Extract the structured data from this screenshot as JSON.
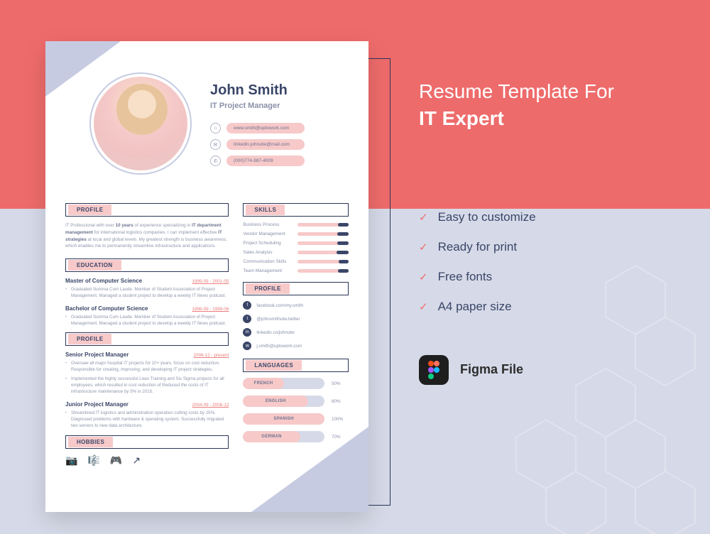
{
  "promo": {
    "heading_line1": "Resume Template For",
    "heading_line2": "IT Expert",
    "features": [
      "Easy to customize",
      "Ready for print",
      "Free fonts",
      "A4 paper size"
    ],
    "figma_label": "Figma File"
  },
  "resume": {
    "name": "John Smith",
    "title": "IT Project Manager",
    "contacts": [
      {
        "kind": "web",
        "glyph": "⌂",
        "value": "www.smith@uptowork.com"
      },
      {
        "kind": "email",
        "glyph": "✉",
        "value": "linkedin.johnutw@mail.com"
      },
      {
        "kind": "phone",
        "glyph": "✆",
        "value": "(000)774-987-4009"
      }
    ],
    "section_labels": {
      "profile": "PROFILE",
      "education": "EDUCATION",
      "experience": "PROFILE",
      "hobbies": "HOBBIES",
      "skills": "SKILLS",
      "social": "PROFILE",
      "languages": "LANGUAGES"
    },
    "profile_text": "IT Professional with over 10 years of experience specializing in IT department management for international logistics companies. I can implement effective IT strategies at local and global levels. My greatest strength is business awareness, which enables me to permanently streamline infrastructure and applications.",
    "education": [
      {
        "degree": "Master of Computer Science",
        "dates": "1999-09 - 2001-05",
        "desc": "Graduated Summa Cum Laude. Member of Student Association of Project Management. Managed a student project to develop a weekly IT News podcast."
      },
      {
        "degree": "Bachelor of Computer Science",
        "dates": "1996-09 - 1999-06",
        "desc": "Graduated Summa Cum Laude. Member of Student Association of Project Management. Managed a student project to develop a weekly IT News podcast."
      }
    ],
    "experience": [
      {
        "role": "Senior Project Manager",
        "dates": "2006-12 - present",
        "bullets": [
          "Oversaw all major hospital IT projects for 10+ years, focus on cost reduction. Responsible for creating, improving, and developing IT project strategies.",
          "Implemented the highly successful Lean Training and Six Sigma projects for all employees, which resulted in cost reduction of Reduced the costs of IT infrastructure maintenance by 5% in 2015."
        ]
      },
      {
        "role": "Junior Project Manager",
        "dates": "2004-09 - 2006-12",
        "bullets": [
          "Streamlined IT logistics and administration operation cutting costs by 25%. Diagnosed problems with hardware & operating system. Successfully migrated two servers to new data architecture."
        ]
      }
    ],
    "skills": [
      {
        "name": "Business Process",
        "pct": 85
      },
      {
        "name": "Vendor Management",
        "pct": 78
      },
      {
        "name": "Project Scheduling",
        "pct": 80
      },
      {
        "name": "Sales Analysis",
        "pct": 72
      },
      {
        "name": "Communication Skills",
        "pct": 88
      },
      {
        "name": "Team Management",
        "pct": 82
      }
    ],
    "social": [
      {
        "icon": "f",
        "text": "facebook.com/my.smith"
      },
      {
        "icon": "t",
        "text": "@johnsmithutw.twitter"
      },
      {
        "icon": "in",
        "text": "linkedin.co/johnutw"
      },
      {
        "icon": "✉",
        "text": "j.smith@uptowork.com"
      }
    ],
    "languages": [
      {
        "name": "FRENCH",
        "pct": 50
      },
      {
        "name": "ENGLISH",
        "pct": 80
      },
      {
        "name": "SPANISH",
        "pct": 100
      },
      {
        "name": "GERMAN",
        "pct": 70
      }
    ],
    "hobbies": [
      "camera",
      "music",
      "game",
      "arrow"
    ]
  }
}
